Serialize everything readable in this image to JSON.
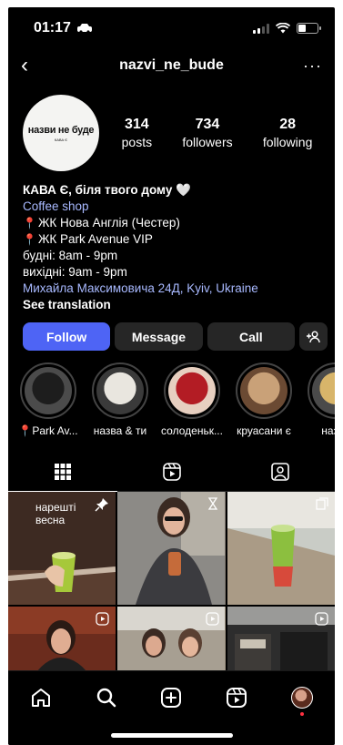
{
  "status": {
    "time": "01:17"
  },
  "header": {
    "username": "nazvi_ne_bude",
    "back_icon": "‹",
    "more_icon": "···"
  },
  "profile": {
    "avatar_title": "назви не буде",
    "avatar_sub": "КАВА Є",
    "stats": [
      {
        "value": "314",
        "label": "posts"
      },
      {
        "value": "734",
        "label": "followers"
      },
      {
        "value": "28",
        "label": "following"
      }
    ]
  },
  "bio": {
    "name": "КАВА Є, біля твого дому 🤍",
    "category": "Coffee shop",
    "lines": [
      "ЖК Нова Англія (Честер)",
      "ЖК Park Avenue VIP",
      "будні: 8am - 9pm",
      "вихідні: 9am - 9pm"
    ],
    "address": "Михайла Максимовича 24Д, Kyiv, Ukraine",
    "translation": "See translation"
  },
  "buttons": {
    "follow": "Follow",
    "message": "Message",
    "call": "Call",
    "add_person": "+⚇"
  },
  "highlights": [
    {
      "label": "📍Park Av...",
      "colors": [
        "#1d1d1d",
        "#4b4b4b"
      ]
    },
    {
      "label": "назва & ти",
      "colors": [
        "#e9e6df",
        "#3a3a3a"
      ]
    },
    {
      "label": "солоденьк...",
      "colors": [
        "#b31c24",
        "#e7cfc0"
      ]
    },
    {
      "label": "круасани є",
      "colors": [
        "#c9a178",
        "#6b4a33"
      ]
    },
    {
      "label": "назва",
      "colors": [
        "#d8b56a",
        "#4a4a4a"
      ]
    }
  ],
  "grid": {
    "pinned_text": "нарешті\nвесна",
    "colors": [
      "#3d2a22",
      "#7d766d",
      "#9bb68a",
      "#5a2e21",
      "#9b8f7e",
      "#2b2b2b"
    ]
  },
  "accent": "#4e64f5"
}
